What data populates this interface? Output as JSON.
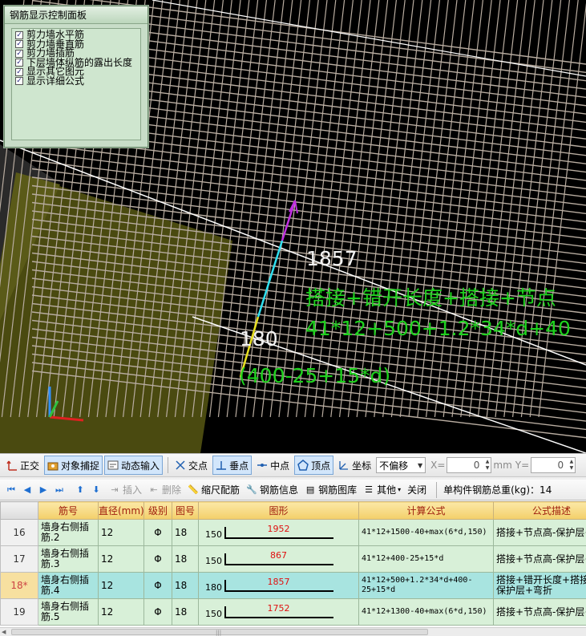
{
  "control_panel": {
    "title": "钢筋显示控制面板",
    "options": [
      {
        "label": "剪力墙水平筋",
        "checked": true
      },
      {
        "label": "剪力墙垂直筋",
        "checked": true
      },
      {
        "label": "剪力墙插筋",
        "checked": true
      },
      {
        "label": "下层墙体纵筋的露出长度",
        "checked": true
      },
      {
        "label": "显示其它图元",
        "checked": true
      },
      {
        "label": "显示详细公式",
        "checked": true
      }
    ]
  },
  "viewport": {
    "upper_length": "1857",
    "upper_description": "搭接+错开长度+搭接+节点",
    "upper_formula": "41*12+500+1.2*34*d+40",
    "lower_length": "180",
    "lower_formula": "(400-25+15*d)"
  },
  "toolbar1": {
    "ortho": "正交",
    "snap": "对象捕捉",
    "dynamic_input": "动态输入",
    "intersection": "交点",
    "perpendicular": "垂点",
    "midpoint": "中点",
    "vertex": "顶点",
    "coordinate": "坐标",
    "offset_select": "不偏移",
    "x_label": "X=",
    "x_value": "0",
    "unit": "mm",
    "y_label": "Y=",
    "y_value": "0"
  },
  "toolbar2": {
    "insert": "插入",
    "delete": "删除",
    "scale_rebar": "缩尺配筋",
    "rebar_info": "钢筋信息",
    "rebar_library": "钢筋图库",
    "other": "其他",
    "close": "关闭",
    "total_weight": "单构件钢筋总重(kg)：14"
  },
  "table": {
    "headers": [
      "筋号",
      "直径(mm)",
      "级别",
      "图号",
      "图形",
      "计算公式",
      "公式描述"
    ],
    "rows": [
      {
        "row": "16",
        "name": "墙身右侧插筋.2",
        "diameter": "12",
        "grade": "Φ",
        "figure": "18",
        "end": "150",
        "length": "1952",
        "formula": "41*12+1500-40+max(6*d,150)",
        "desc": "搭接+节点高-保护层+",
        "selected": false
      },
      {
        "row": "17",
        "name": "墙身右侧插筋.3",
        "diameter": "12",
        "grade": "Φ",
        "figure": "18",
        "end": "150",
        "length": "867",
        "formula": "41*12+400-25+15*d",
        "desc": "搭接+节点高-保护层+",
        "selected": false
      },
      {
        "row": "18*",
        "name": "墙身右侧插筋.4",
        "diameter": "12",
        "grade": "Φ",
        "figure": "18",
        "end": "180",
        "length": "1857",
        "formula": "41*12+500+1.2*34*d+400-25+15*d",
        "desc": "搭接+错开长度+搭接+-保护层+弯折",
        "selected": true
      },
      {
        "row": "19",
        "name": "墙身右侧插筋.5",
        "diameter": "12",
        "grade": "Φ",
        "figure": "18",
        "end": "150",
        "length": "1752",
        "formula": "41*12+1300-40+max(6*d,150)",
        "desc": "搭接+节点高-保护层+",
        "selected": false
      }
    ]
  }
}
